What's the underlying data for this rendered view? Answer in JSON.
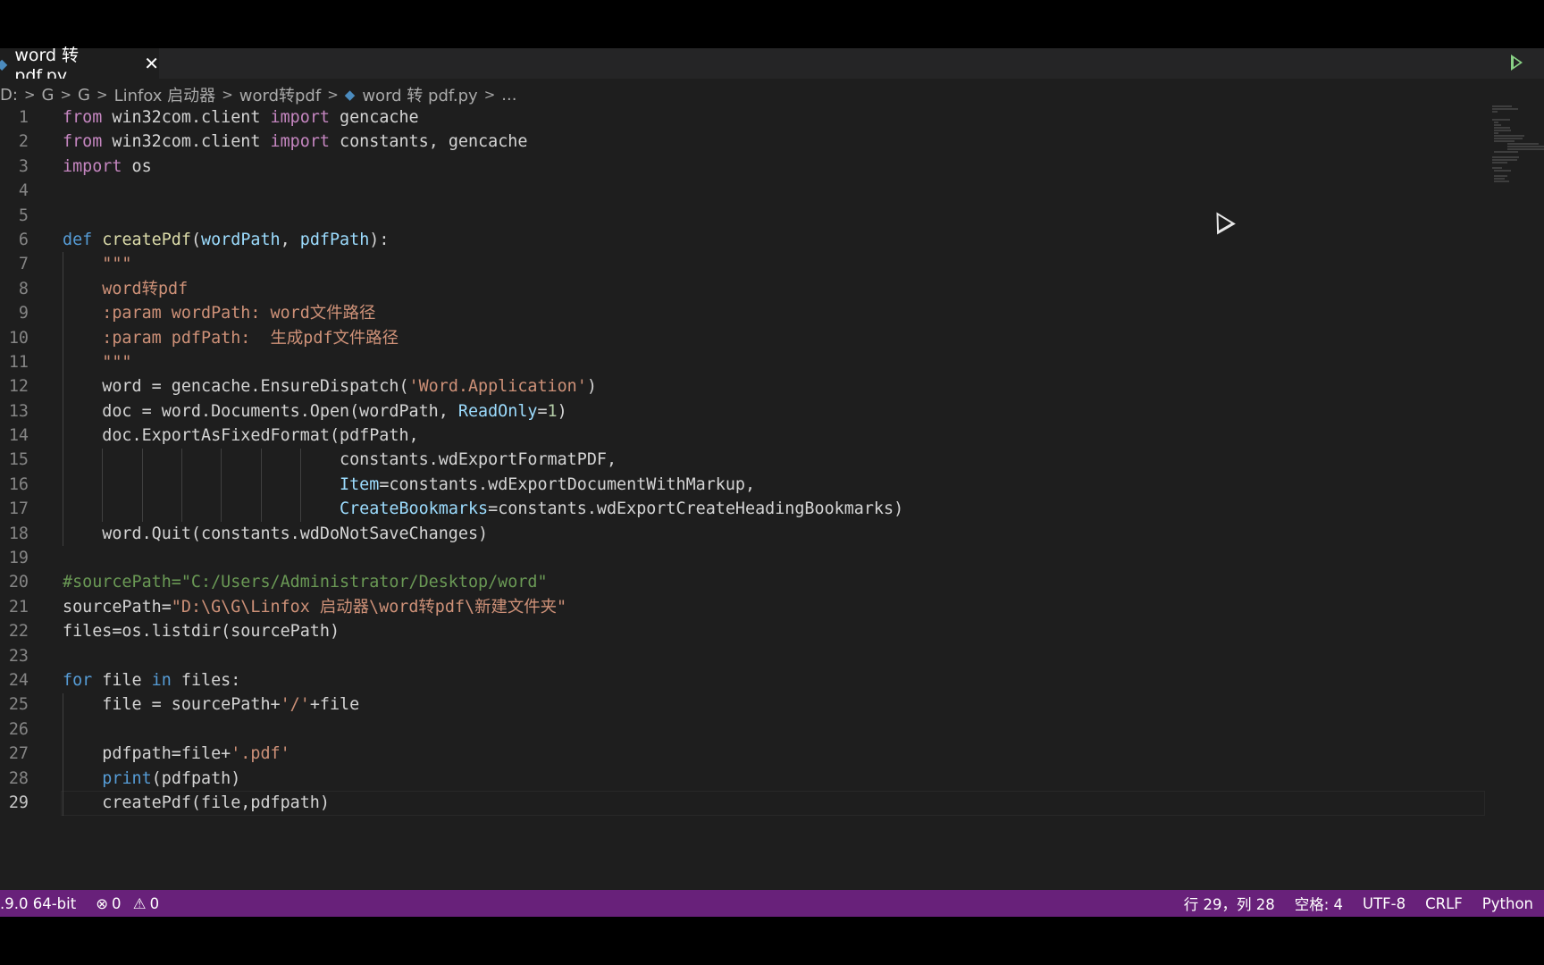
{
  "tab": {
    "title": "word 转 pdf.py",
    "close_glyph": "✕",
    "icon": "python-file-icon"
  },
  "breadcrumb": {
    "segments": [
      "D:",
      "G",
      "G",
      "Linfox 启动器",
      "word转pdf",
      "word 转 pdf.py",
      "..."
    ],
    "separator": ">"
  },
  "editor": {
    "active_line": 29,
    "lines": [
      "from win32com.client import gencache",
      "from win32com.client import constants, gencache",
      "import os",
      "",
      "",
      "def createPdf(wordPath, pdfPath):",
      "    \"\"\"",
      "    word转pdf",
      "    :param wordPath: word文件路径",
      "    :param pdfPath:  生成pdf文件路径",
      "    \"\"\"",
      "    word = gencache.EnsureDispatch('Word.Application')",
      "    doc = word.Documents.Open(wordPath, ReadOnly=1)",
      "    doc.ExportAsFixedFormat(pdfPath,",
      "                            constants.wdExportFormatPDF,",
      "                            Item=constants.wdExportDocumentWithMarkup,",
      "                            CreateBookmarks=constants.wdExportCreateHeadingBookmarks)",
      "    word.Quit(constants.wdDoNotSaveChanges)",
      "",
      "#sourcePath=\"C:/Users/Administrator/Desktop/word\"",
      "sourcePath=\"D:\\G\\G\\Linfox 启动器\\word转pdf\\新建文件夹\"",
      "files=os.listdir(sourcePath)",
      "",
      "for file in files:",
      "    file = sourcePath+'/'+file",
      "",
      "    pdfpath=file+'.pdf'",
      "    print(pdfpath)",
      "    createPdf(file,pdfpath)"
    ]
  },
  "status_bar": {
    "interpreter": ".9.0 64-bit",
    "errors": "0",
    "warnings": "0",
    "cursor_position": "行 29，列 28",
    "indentation": "空格: 4",
    "encoding": "UTF-8",
    "line_ending": "CRLF",
    "language": "Python",
    "color": "#68217a"
  }
}
